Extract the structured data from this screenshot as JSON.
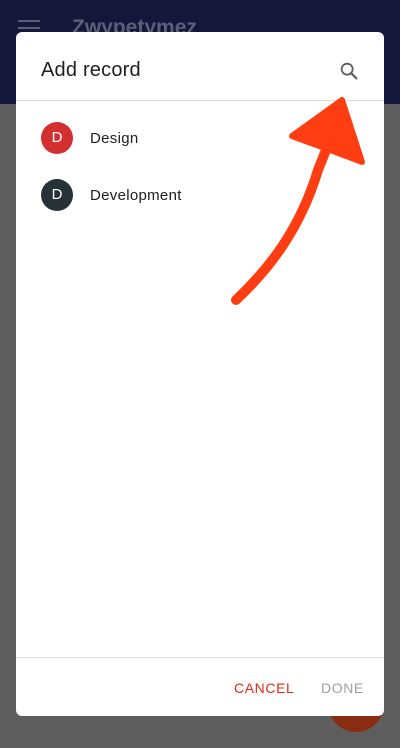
{
  "app": {
    "title": "Zwypetymez"
  },
  "dialog": {
    "title": "Add record",
    "search_icon": "search-icon",
    "items": [
      {
        "initial": "D",
        "label": "Design",
        "color": "#d32f2f"
      },
      {
        "initial": "D",
        "label": "Development",
        "color": "#263238"
      }
    ],
    "cancel_label": "CANCEL",
    "done_label": "DONE"
  },
  "colors": {
    "app_bar": "#14173a",
    "accent": "#e32a0f",
    "annotation_arrow": "#ff3d12",
    "disabled_text": "#a0a0a0"
  }
}
